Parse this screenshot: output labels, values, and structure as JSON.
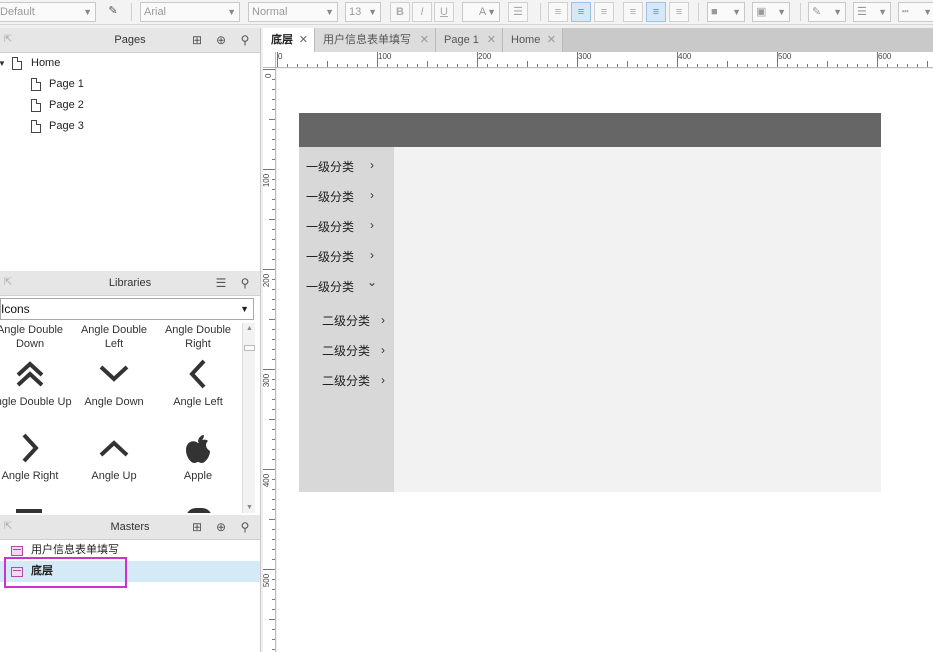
{
  "toolbar": {
    "style_select": "Default",
    "font_select": "Arial",
    "weight_select": "Normal",
    "size_select": "13",
    "bold": "B",
    "italic": "I",
    "underline": "U",
    "font_color": "A"
  },
  "pages_panel": {
    "title": "Pages",
    "items": [
      {
        "label": "Home"
      },
      {
        "label": "Page 1"
      },
      {
        "label": "Page 2"
      },
      {
        "label": "Page 3"
      }
    ]
  },
  "libraries_panel": {
    "title": "Libraries",
    "selected_library": "Icons",
    "items": [
      {
        "label_line1": "Angle Double",
        "label_line2": "Down",
        "icon": "angle-double-down-icon"
      },
      {
        "label_line1": "Angle Double",
        "label_line2": "Left",
        "icon": "angle-double-left-icon"
      },
      {
        "label_line1": "Angle Double",
        "label_line2": "Right",
        "icon": "angle-double-right-icon"
      },
      {
        "label": "Angle Double Up",
        "icon": "angle-double-up-icon",
        "glyph": "︽"
      },
      {
        "label": "Angle Down",
        "icon": "angle-down-icon",
        "glyph": "﹀"
      },
      {
        "label": "Angle Left",
        "icon": "angle-left-icon",
        "glyph": "〈"
      },
      {
        "label": "Angle Right",
        "icon": "angle-right-icon",
        "glyph": "〉"
      },
      {
        "label": "Angle Up",
        "icon": "angle-up-icon",
        "glyph": "︿"
      },
      {
        "label": "Apple",
        "icon": "apple-icon",
        "glyph": ""
      }
    ]
  },
  "masters_panel": {
    "title": "Masters",
    "items": [
      {
        "label": "用户信息表单填写"
      },
      {
        "label": "底层",
        "selected": true
      }
    ]
  },
  "tabs": [
    {
      "label": "底层",
      "active": true
    },
    {
      "label": "用户信息表单填写"
    },
    {
      "label": "Page 1"
    },
    {
      "label": "Home"
    }
  ],
  "ruler": {
    "h_labels": [
      "0",
      "100",
      "200",
      "300",
      "400",
      "500",
      "600"
    ],
    "v_labels": [
      "0",
      "100",
      "200",
      "300",
      "400",
      "500"
    ]
  },
  "canvas": {
    "header_color": "#666666",
    "menu_color": "#d8d8d8",
    "content_color": "#f2f2f2",
    "menu_items": [
      {
        "label": "一级分类",
        "chevron": "›"
      },
      {
        "label": "一级分类",
        "chevron": "›"
      },
      {
        "label": "一级分类",
        "chevron": "›"
      },
      {
        "label": "一级分类",
        "chevron": "›"
      },
      {
        "label": "一级分类",
        "chevron": "⌄",
        "expanded": true
      }
    ],
    "sub_items": [
      {
        "label": "二级分类",
        "chevron": "›"
      },
      {
        "label": "二级分类",
        "chevron": "›"
      },
      {
        "label": "二级分类",
        "chevron": "›"
      }
    ]
  },
  "colors": {
    "selection_outline": "#cc33cc",
    "selected_row": "#d4eaf7",
    "active_align": "#d6e8f7"
  }
}
